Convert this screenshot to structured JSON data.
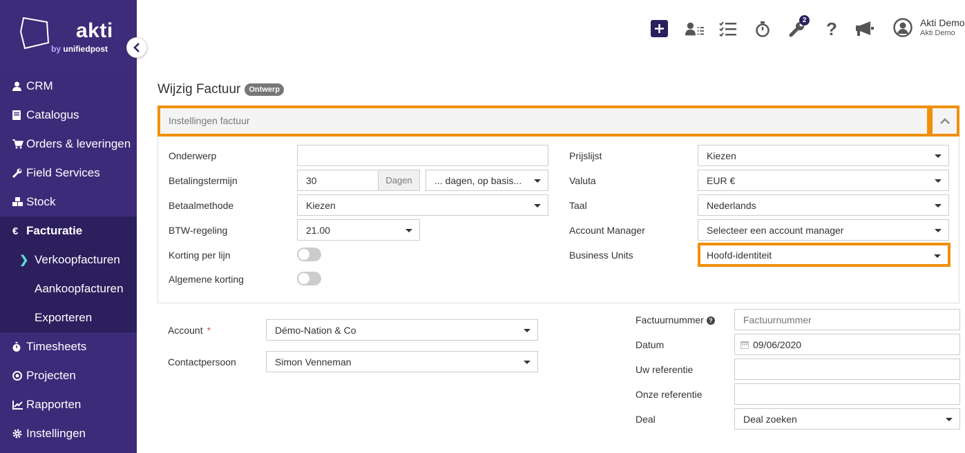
{
  "brand": {
    "name": "akti",
    "sub_by": "by",
    "sub_name": "unifiedpost"
  },
  "sidebar": {
    "items": [
      {
        "label": "CRM",
        "icon": "user-icon"
      },
      {
        "label": "Catalogus",
        "icon": "book-icon"
      },
      {
        "label": "Orders & leveringen",
        "icon": "cart-icon"
      },
      {
        "label": "Field Services",
        "icon": "wrench-icon"
      },
      {
        "label": "Stock",
        "icon": "cubes-icon"
      },
      {
        "label": "Facturatie",
        "icon": "euro-icon"
      },
      {
        "label": "Timesheets",
        "icon": "stopwatch-icon"
      },
      {
        "label": "Projecten",
        "icon": "target-icon"
      },
      {
        "label": "Rapporten",
        "icon": "chart-icon"
      },
      {
        "label": "Instellingen",
        "icon": "gear-icon"
      }
    ],
    "subitems": [
      {
        "label": "Verkoopfacturen"
      },
      {
        "label": "Aankoopfacturen"
      },
      {
        "label": "Exporteren"
      }
    ]
  },
  "header": {
    "notification_count": "2",
    "user_name": "Akti Demo",
    "user_org": "Akti Demo"
  },
  "page": {
    "title": "Wijzig Factuur",
    "status": "Ontwerp"
  },
  "section": {
    "title": "Instellingen factuur"
  },
  "settings": {
    "onderwerp_label": "Onderwerp",
    "onderwerp_value": "",
    "betalingstermijn_label": "Betalingstermijn",
    "betalingstermijn_value": "30",
    "betalingstermijn_unit": "Dagen",
    "betalingstermijn_basis": "... dagen, op basis...",
    "betaalmethode_label": "Betaalmethode",
    "betaalmethode_value": "Kiezen",
    "btw_label": "BTW-regeling",
    "btw_value": "21.00",
    "korting_lijn_label": "Korting per lijn",
    "algemene_korting_label": "Algemene korting",
    "prijslijst_label": "Prijslijst",
    "prijslijst_value": "Kiezen",
    "valuta_label": "Valuta",
    "valuta_value": "EUR €",
    "taal_label": "Taal",
    "taal_value": "Nederlands",
    "account_manager_label": "Account Manager",
    "account_manager_value": "Selecteer een account manager",
    "business_units_label": "Business Units",
    "business_units_value": "Hoofd-identiteit"
  },
  "invoice": {
    "account_label": "Account",
    "account_required": "*",
    "account_value": "Démo-Nation & Co",
    "contact_label": "Contactpersoon",
    "contact_value": "Simon Venneman",
    "factuurnummer_label": "Factuurnummer",
    "factuurnummer_placeholder": "Factuurnummer",
    "datum_label": "Datum",
    "datum_value": "09/06/2020",
    "uw_ref_label": "Uw referentie",
    "onze_ref_label": "Onze referentie",
    "deal_label": "Deal",
    "deal_value": "Deal zoeken"
  }
}
